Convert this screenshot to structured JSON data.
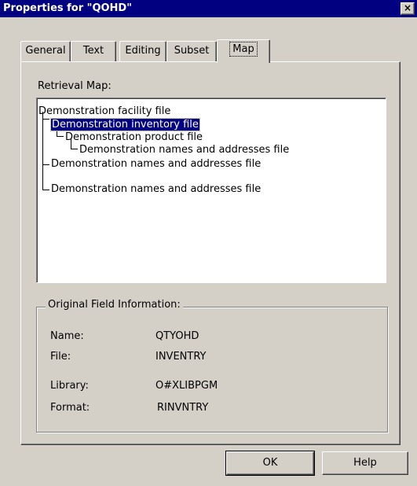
{
  "window": {
    "title": "Properties for \"QOHD\"",
    "close_label": "×"
  },
  "tabs": [
    {
      "label": "General",
      "active": false
    },
    {
      "label": "Text",
      "active": false
    },
    {
      "label": "Editing",
      "active": false
    },
    {
      "label": "Subset",
      "active": false
    },
    {
      "label": "Map",
      "active": true
    }
  ],
  "retrieval_map": {
    "label": "Retrieval Map:",
    "items": [
      {
        "label": "Demonstration facility file",
        "selected": false
      },
      {
        "label": "Demonstration inventory file",
        "selected": true
      },
      {
        "label": "Demonstration product file",
        "selected": false
      },
      {
        "label": "Demonstration names and addresses file",
        "selected": false
      },
      {
        "label": "Demonstration names and addresses file",
        "selected": false
      },
      {
        "label": "Demonstration names and addresses file",
        "selected": false
      }
    ]
  },
  "field_info": {
    "legend": "Original Field Information:",
    "rows": [
      {
        "label": "Name:",
        "value": "QTYOHD"
      },
      {
        "label": "File:",
        "value": "INVENTRY"
      },
      {
        "label": "Library:",
        "value": "O#XLIBPGM"
      },
      {
        "label": "Format:",
        "value": "RINVNTRY"
      }
    ]
  },
  "buttons": {
    "ok": "OK",
    "help": "Help"
  }
}
